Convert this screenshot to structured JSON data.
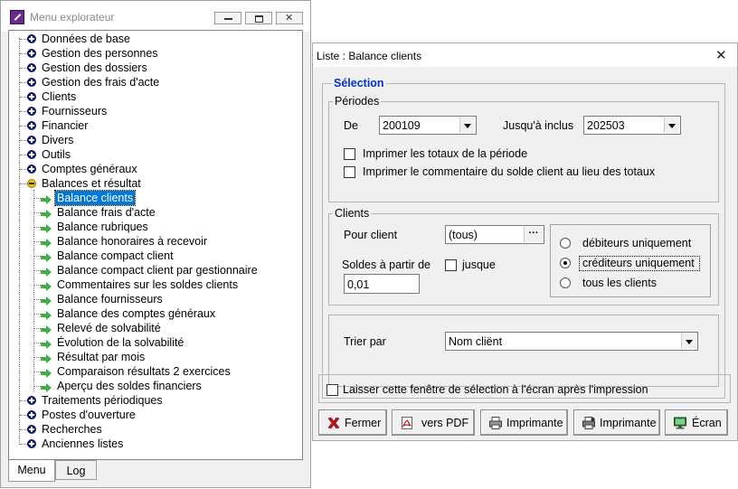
{
  "explorer": {
    "title": "Menu explorateur",
    "tree": [
      {
        "label": "Données de base",
        "state": "collapsed"
      },
      {
        "label": "Gestion des personnes",
        "state": "collapsed"
      },
      {
        "label": "Gestion des dossiers",
        "state": "collapsed"
      },
      {
        "label": "Gestion des frais d'acte",
        "state": "collapsed"
      },
      {
        "label": "Clients",
        "state": "collapsed"
      },
      {
        "label": "Fournisseurs",
        "state": "collapsed"
      },
      {
        "label": "Financier",
        "state": "collapsed"
      },
      {
        "label": "Divers",
        "state": "collapsed"
      },
      {
        "label": "Outils",
        "state": "collapsed"
      },
      {
        "label": "Comptes généraux",
        "state": "collapsed"
      },
      {
        "label": "Balances et résultat",
        "state": "expanded"
      },
      {
        "label": "Traitements périodiques",
        "state": "collapsed"
      },
      {
        "label": "Postes d'ouverture",
        "state": "collapsed"
      },
      {
        "label": "Recherches",
        "state": "collapsed"
      },
      {
        "label": "Anciennes listes",
        "state": "collapsed"
      }
    ],
    "children": [
      "Balance clients",
      "Balance frais d'acte",
      "Balance rubriques",
      "Balance honoraires à recevoir",
      "Balance compact client",
      "Balance compact client par gestionnaire",
      "Commentaires sur les soldes clients",
      "Balance fournisseurs",
      "Balance des comptes généraux",
      "Relevé de solvabilité",
      "Évolution de la solvabilité",
      "Résultat par mois",
      "Comparaison résultats 2 exercices",
      "Aperçu des soldes financiers"
    ],
    "selected_child": "Balance clients",
    "tabs": [
      "Menu",
      "Log"
    ],
    "active_tab": "Menu"
  },
  "dialog": {
    "title": "Liste : Balance clients",
    "selection_label": "Sélection",
    "periods": {
      "label": "Périodes",
      "from_label": "De",
      "from_value": "200109",
      "to_label": "Jusqu'à inclus",
      "to_value": "202503",
      "print_totals": "Imprimer les totaux de la période",
      "print_comment": "Imprimer le commentaire du solde client au lieu des totaux"
    },
    "clients": {
      "label": "Clients",
      "per_client_label": "Pour client",
      "per_client_value": "(tous)",
      "balances_from_label": "Soldes à partir de",
      "balances_from_value": "0,01",
      "until_label": "jusque",
      "radio_debtors": "débiteurs uniquement",
      "radio_creditors": "créditeurs uniquement",
      "radio_all": "tous les clients",
      "selected_radio": "créditeurs uniquement"
    },
    "sort": {
      "label": "Trier par",
      "value": "Nom cliënt"
    },
    "keep_window": "Laisser cette fenêtre de sélection à l'écran après l'impression",
    "buttons": {
      "close": "Fermer",
      "pdf": "vers PDF",
      "printer1": "Imprimante",
      "printer2": "Imprimante",
      "screen": "Écran"
    }
  },
  "colors": {
    "selection_blue": "#0033cc",
    "tree_selected_bg": "#0078d7",
    "arrow_green": "#3cb043",
    "close_red": "#c0161b"
  }
}
